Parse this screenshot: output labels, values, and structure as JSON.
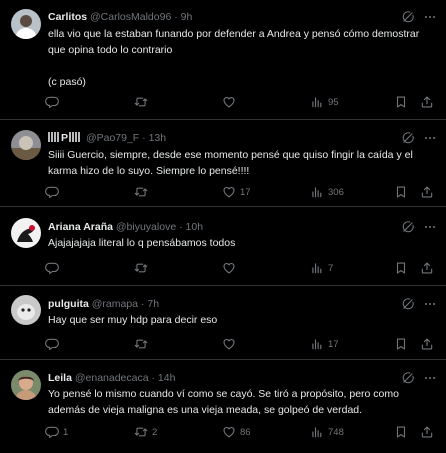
{
  "tweets": [
    {
      "name": "Carlitos",
      "handle": "@CarlosMaldo96",
      "separator": "·",
      "time": "9h",
      "text": "ella vio que la estaban funando por defender a Andrea y pensó cómo demostrar que opina todo lo contrario\n\n(c pasó)",
      "replies": "",
      "retweets": "",
      "likes": "",
      "views": "95",
      "avatar_color": "#b9c2c9"
    },
    {
      "name": "P",
      "handle": "@Pao79_F",
      "separator": "·",
      "time": "13h",
      "text": "Siiii Guercio, siempre, desde ese momento pensé que quiso fingir la caída y el karma hizo de lo suyo. Siempre lo pensé!!!!",
      "replies": "",
      "retweets": "",
      "likes": "17",
      "views": "306",
      "avatar_color": "#8d8f94"
    },
    {
      "name": "Ariana Araña",
      "handle": "@biyuyalove",
      "separator": "·",
      "time": "10h",
      "text": "Ajajajajaja literal lo q pensábamos todos",
      "replies": "",
      "retweets": "",
      "likes": "",
      "views": "7",
      "avatar_color": "#f2f2f2"
    },
    {
      "name": "pulguita",
      "handle": "@ramapa",
      "separator": "·",
      "time": "7h",
      "text": "Hay que ser muy hdp para decir eso",
      "replies": "",
      "retweets": "",
      "likes": "",
      "views": "17",
      "avatar_color": "#c9c9c9"
    },
    {
      "name": "Leila",
      "handle": "@enanadecaca",
      "separator": "·",
      "time": "14h",
      "text": "Yo pensé lo mismo cuando ví como se cayó. Se tiró a propósito, pero como además de vieja maligna es una vieja meada, se golpeó de verdad.",
      "replies": "1",
      "retweets": "2",
      "likes": "86",
      "views": "748",
      "avatar_color": "#c79a7a"
    }
  ],
  "icons": {
    "reply": "reply-icon",
    "retweet": "retweet-icon",
    "like": "heart-icon",
    "views": "views-icon",
    "bookmark": "bookmark-icon",
    "share": "share-icon",
    "grok": "grok-icon",
    "more": "more-icon"
  },
  "colors": {
    "background": "#000000",
    "text": "#e7e9ea",
    "muted": "#71767b",
    "divider": "#2f3336"
  }
}
